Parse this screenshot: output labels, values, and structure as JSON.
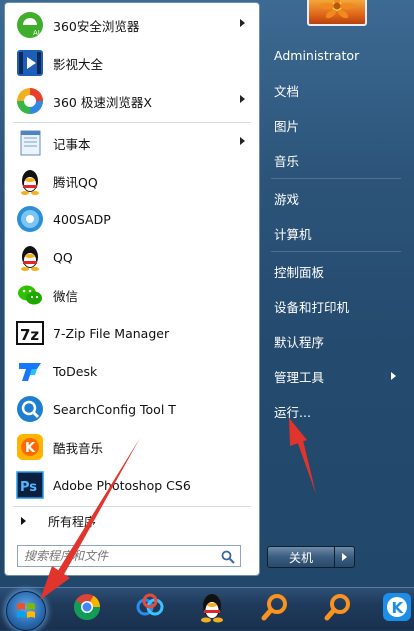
{
  "left_panel": {
    "apps": [
      {
        "label": "360安全浏览器",
        "icon": "360-security-browser-icon",
        "has_arrow": true
      },
      {
        "label": "影视大全",
        "icon": "video-player-icon",
        "has_arrow": false
      },
      {
        "label": "360 极速浏览器X",
        "icon": "360-speed-browser-icon",
        "has_arrow": true
      },
      {
        "label": "记事本",
        "icon": "notepad-icon",
        "has_arrow": true
      },
      {
        "label": "腾讯QQ",
        "icon": "qq-penguin-icon",
        "has_arrow": false
      },
      {
        "label": "400SADP",
        "icon": "sadp-icon",
        "has_arrow": false
      },
      {
        "label": "QQ",
        "icon": "qq-penguin-icon",
        "has_arrow": false
      },
      {
        "label": "微信",
        "icon": "wechat-icon",
        "has_arrow": false
      },
      {
        "label": "7-Zip File Manager",
        "icon": "7zip-icon",
        "has_arrow": false
      },
      {
        "label": "ToDesk",
        "icon": "todesk-icon",
        "has_arrow": false
      },
      {
        "label": "SearchConfig Tool T",
        "icon": "searchconfig-icon",
        "has_arrow": false
      },
      {
        "label": "酷我音乐",
        "icon": "kuwo-music-icon",
        "has_arrow": false
      },
      {
        "label": "Adobe Photoshop CS6",
        "icon": "photoshop-icon",
        "has_arrow": false
      }
    ],
    "all_programs_label": "所有程序",
    "search_placeholder": "搜索程序和文件"
  },
  "right_panel": {
    "items": [
      {
        "label": "Administrator",
        "has_arrow": false
      },
      {
        "label": "文档",
        "has_arrow": false
      },
      {
        "label": "图片",
        "has_arrow": false
      },
      {
        "label": "音乐",
        "has_arrow": false
      },
      {
        "label": "游戏",
        "has_arrow": false
      },
      {
        "label": "计算机",
        "has_arrow": false
      },
      {
        "label": "控制面板",
        "has_arrow": false
      },
      {
        "label": "设备和打印机",
        "has_arrow": false
      },
      {
        "label": "默认程序",
        "has_arrow": false
      },
      {
        "label": "管理工具",
        "has_arrow": true
      },
      {
        "label": "运行...",
        "has_arrow": false
      }
    ],
    "shutdown_label": "关机"
  },
  "taskbar": {
    "items": [
      "start-orb-icon",
      "chrome-icon",
      "baidu-netdisk-icon",
      "qq-penguin-icon",
      "search-tool-icon",
      "search-tool-icon",
      "kuaishou-k-icon"
    ]
  },
  "colors": {
    "annotation_arrow": "#e0342c",
    "menu_frame": "#2c5479",
    "left_panel": "#ffffff"
  }
}
